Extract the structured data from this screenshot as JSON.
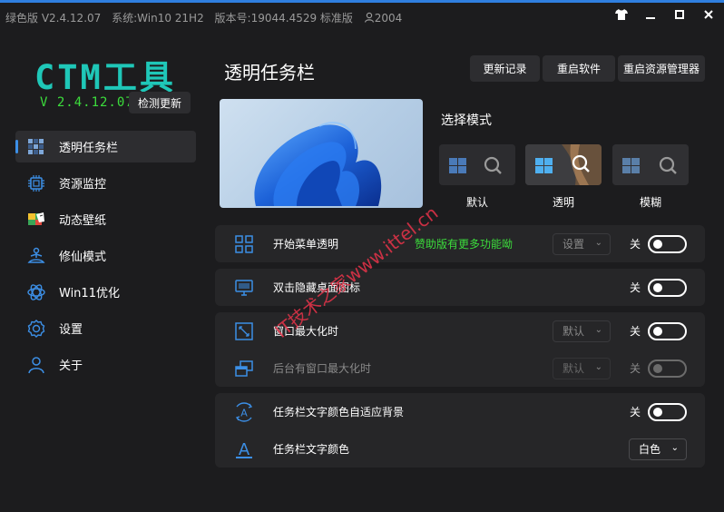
{
  "window": {
    "edition": "绿色版 V2.4.12.07",
    "system": "系统:Win10 21H2",
    "build": "版本号:19044.4529 标准版",
    "user_count": "2004"
  },
  "sidebar": {
    "logo": "CTM工具",
    "version": "V 2.4.12.07",
    "check_update": "检测更新",
    "items": [
      {
        "label": "透明任务栏",
        "icon": "taskbar-icon"
      },
      {
        "label": "资源监控",
        "icon": "cpu-icon"
      },
      {
        "label": "动态壁纸",
        "icon": "wallpaper-icon"
      },
      {
        "label": "修仙模式",
        "icon": "meditate-icon"
      },
      {
        "label": "Win11优化",
        "icon": "atom-icon"
      },
      {
        "label": "设置",
        "icon": "gear-icon"
      },
      {
        "label": "关于",
        "icon": "user-icon"
      }
    ]
  },
  "main": {
    "title": "透明任务栏",
    "buttons": [
      "更新记录",
      "重启软件",
      "重启资源管理器"
    ],
    "mode_label": "选择模式",
    "modes": [
      "默认",
      "透明",
      "模糊"
    ],
    "selected_mode": "透明",
    "settings": {
      "start_menu": {
        "label": "开始菜单透明",
        "promo": "赞助版有更多功能呦",
        "select": "设置",
        "state": "关"
      },
      "hide_icons": {
        "label": "双击隐藏桌面图标",
        "state": "关"
      },
      "maximize": {
        "label": "窗口最大化时",
        "select": "默认",
        "state": "关"
      },
      "bg_maximize": {
        "label": "后台有窗口最大化时",
        "select": "默认",
        "state": "关"
      },
      "text_adapt": {
        "label": "任务栏文字颜色自适应背景",
        "state": "关"
      },
      "text_color": {
        "label": "任务栏文字颜色",
        "select": "白色"
      }
    }
  },
  "watermark": "IT技术之家www.ittel.cn",
  "colors": {
    "accent": "#3c8fe6",
    "logo": "#1fc7b8",
    "version": "#3cdd3c",
    "watermark": "#e8334a"
  }
}
